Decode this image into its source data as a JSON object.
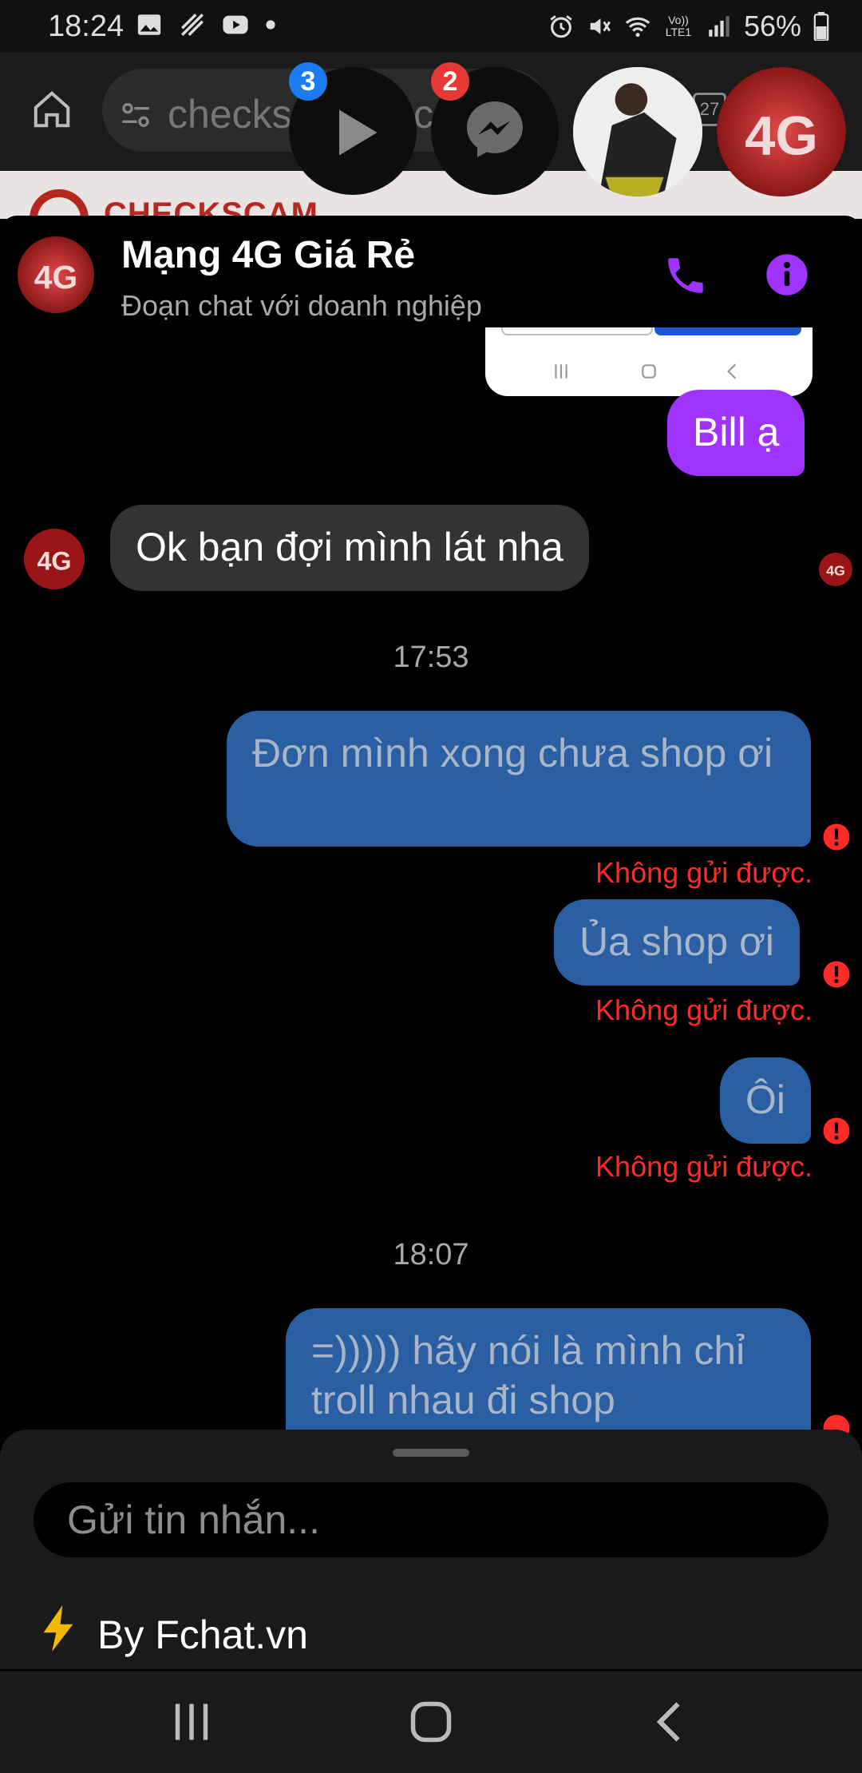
{
  "status_bar": {
    "time": "18:24",
    "left_icons": [
      "gallery-icon",
      "pattern-icon",
      "youtube-icon",
      "dot-icon"
    ],
    "right_icons": [
      "alarm-icon",
      "mute-icon",
      "wifi-icon",
      "volte-lte-icon",
      "signal-icon"
    ],
    "volte_label": "Vo)) LTE1",
    "battery": "56%"
  },
  "browser": {
    "url": "checks",
    "url_tail": "c",
    "site_logo_text": "CHECKSCAM",
    "tab_count": "27"
  },
  "chat_heads": {
    "badge_play": "3",
    "badge_messenger": "2",
    "badge_colors": {
      "blue": "#1a7cf0",
      "red": "#e53935"
    }
  },
  "header": {
    "title": "Mạng 4G Giá Rẻ",
    "subtitle": "Đoạn chat với doanh nghiệp",
    "avatar_text": "4G",
    "accent": "#a033ff"
  },
  "messages": {
    "m1": "Bill ạ",
    "m2": "Ok bạn đợi mình lát nha",
    "time1": "17:53",
    "m3": "Đơn mình xong chưa shop ơi",
    "m4": "Ủa shop ơi",
    "m5": "Ôi",
    "time2": "18:07",
    "m6": "=))))) hãy nói là mình chỉ troll nhau đi shop",
    "fail_label": "Không gửi được."
  },
  "composer": {
    "placeholder": "Gửi tin nhắn...",
    "byline": "By Fchat.vn"
  },
  "navbar": {
    "icons": [
      "recent-apps-icon",
      "home-icon",
      "back-icon"
    ]
  }
}
